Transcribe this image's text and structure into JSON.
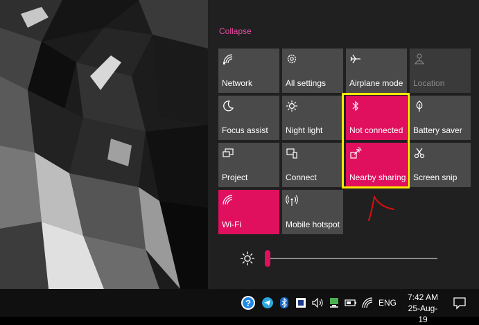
{
  "panel": {
    "collapse_label": "Collapse"
  },
  "tiles": [
    {
      "label": "Network",
      "icon": "network-icon",
      "state": "off"
    },
    {
      "label": "All settings",
      "icon": "gear-icon",
      "state": "off"
    },
    {
      "label": "Airplane mode",
      "icon": "airplane-icon",
      "state": "off"
    },
    {
      "label": "Location",
      "icon": "location-icon",
      "state": "disabled"
    },
    {
      "label": "Focus assist",
      "icon": "moon-icon",
      "state": "off"
    },
    {
      "label": "Night light",
      "icon": "sun-icon",
      "state": "off"
    },
    {
      "label": "Not connected",
      "icon": "bluetooth-icon",
      "state": "on"
    },
    {
      "label": "Battery saver",
      "icon": "leaf-icon",
      "state": "off"
    },
    {
      "label": "Project",
      "icon": "project-icon",
      "state": "off"
    },
    {
      "label": "Connect",
      "icon": "connect-icon",
      "state": "off"
    },
    {
      "label": "Nearby sharing",
      "icon": "share-icon",
      "state": "on"
    },
    {
      "label": "Screen snip",
      "icon": "scissors-icon",
      "state": "off"
    },
    {
      "label": "Wi-Fi",
      "icon": "wifi-icon",
      "state": "on"
    },
    {
      "label": "Mobile hotspot",
      "icon": "hotspot-icon",
      "state": "off"
    }
  ],
  "brightness": {
    "level_fraction": 0.0
  },
  "taskbar": {
    "tray_icons": [
      "help-icon",
      "telegram-icon",
      "bluetooth-icon",
      "app-icon",
      "volume-icon",
      "network-icon",
      "battery-icon",
      "wifi-icon"
    ],
    "language": "ENG",
    "time": "7:42 AM",
    "date": "25-Aug-19"
  },
  "colors": {
    "accent": "#e0105e",
    "highlight": "#ffea00",
    "tile": "#4a4a4a",
    "panel": "#202020"
  }
}
